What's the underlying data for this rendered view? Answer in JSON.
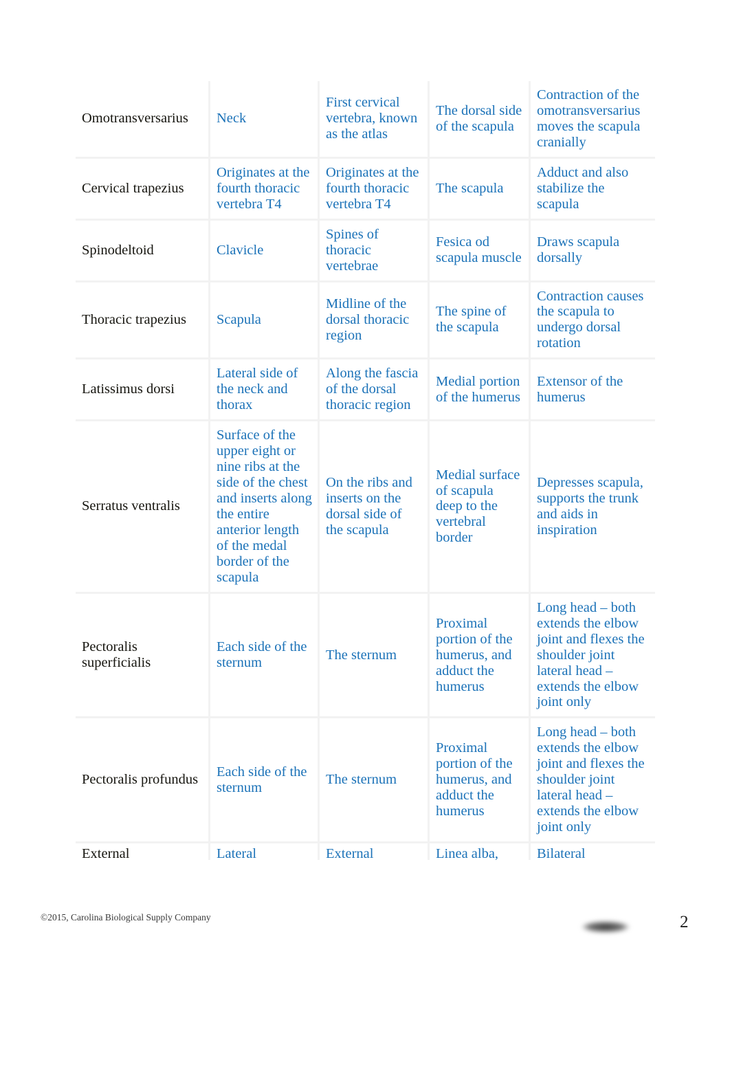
{
  "document": {
    "page_number": "2",
    "copyright": "©2015, Carolina Biological Supply Company",
    "redaction_label": "redacted-block"
  },
  "colors": {
    "body_text": "#16150f",
    "accent_blue": "#1b72b8",
    "cell_border": "#f2f2f2",
    "page_background": "#ffffff"
  },
  "table": {
    "columns": 5,
    "rows": [
      {
        "name": "Omotransversarius",
        "origin": "Neck",
        "insertion": "First cervical vertebra, known as the atlas",
        "location": "The dorsal side of the scapula",
        "action": "Contraction of the omotransversarius moves the scapula cranially"
      },
      {
        "name": "Cervical trapezius",
        "origin": "Originates at the fourth thoracic vertebra T4",
        "insertion": "Originates at the fourth thoracic vertebra T4",
        "location": "The scapula",
        "action": "Adduct and also stabilize the scapula"
      },
      {
        "name": "Spinodeltoid",
        "origin": "Clavicle",
        "insertion": "Spines of thoracic vertebrae",
        "location": "Fesica od scapula muscle",
        "action": "Draws scapula dorsally"
      },
      {
        "name": "Thoracic trapezius",
        "origin": "Scapula",
        "insertion": "Midline of the dorsal thoracic region",
        "location": "The spine of the scapula",
        "action": "Contraction causes the scapula to undergo dorsal rotation"
      },
      {
        "name": "Latissimus dorsi",
        "origin": "Lateral side of the neck and thorax",
        "insertion": "Along the fascia of the dorsal thoracic region",
        "location": "Medial portion of the humerus",
        "action": "Extensor of the humerus"
      },
      {
        "name": "Serratus ventralis",
        "origin": "Surface of the upper eight or nine ribs at the side of the chest and inserts along the entire anterior length of the medal border of the scapula",
        "insertion": "On the ribs and inserts on the dorsal side of the scapula",
        "location": "Medial surface of scapula deep to the vertebral border",
        "action": "Depresses scapula, supports the trunk and aids in inspiration"
      },
      {
        "name": "Pectoralis superficialis",
        "origin": "Each side of the sternum",
        "insertion": "The sternum",
        "location": "Proximal portion of the humerus, and adduct the humerus",
        "action": "Long head – both extends the elbow joint and flexes the shoulder joint lateral head – extends the elbow joint only"
      },
      {
        "name": "Pectoralis profundus",
        "origin": "Each side of the sternum",
        "insertion": "The sternum",
        "location": "Proximal portion of the humerus, and adduct the humerus",
        "action": "Long head – both extends the elbow joint and flexes the shoulder joint lateral head – extends the elbow joint only"
      },
      {
        "name": "External",
        "origin": "Lateral",
        "insertion": "External",
        "location": "Linea alba,",
        "action": "Bilateral"
      }
    ]
  }
}
